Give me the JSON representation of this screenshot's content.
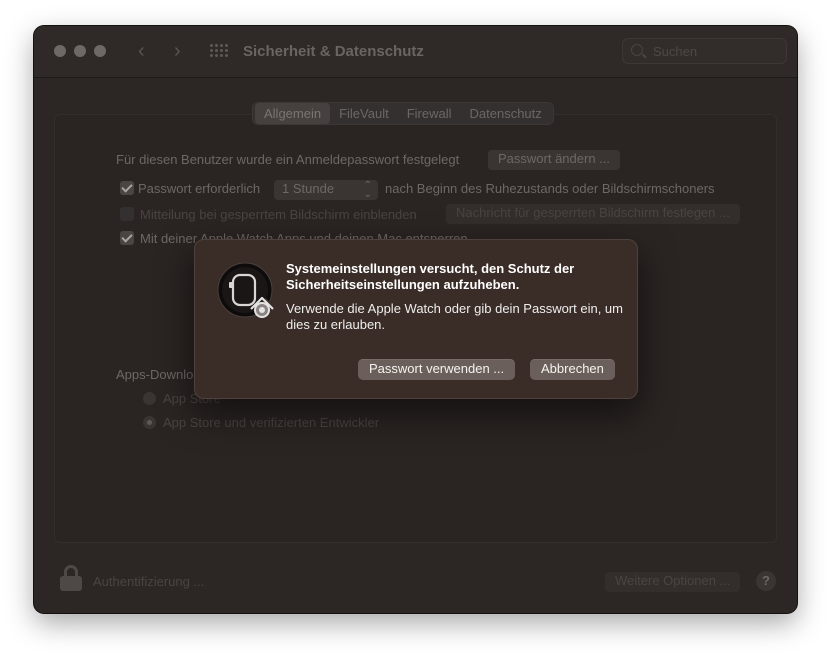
{
  "window": {
    "title": "Sicherheit & Datenschutz"
  },
  "search": {
    "placeholder": "Suchen"
  },
  "tabs": [
    "Allgemein",
    "FileVault",
    "Firewall",
    "Datenschutz"
  ],
  "general": {
    "password_set_text": "Für diesen Benutzer wurde ein Anmeldepasswort festgelegt",
    "change_password_button": "Passwort ändern ...",
    "require_password_label": "Passwort erforderlich",
    "require_password_delay": "1 Stunde",
    "require_password_suffix": "nach Beginn des Ruhezustands oder Bildschirmschoners",
    "lock_message_label": "Mitteilung bei gesperrtem Bildschirm einblenden",
    "lock_message_button": "Nachricht für gesperrten Bildschirm festlegen ...",
    "apple_watch_label": "Mit deiner Apple Watch Apps und deinen Mac entsperren"
  },
  "apps_download": {
    "heading": "Apps-Download erlauben von:",
    "option_app_store": "App Store",
    "option_app_store_devs": "App Store und verifizierten Entwickler"
  },
  "footer": {
    "auth_text": "Authentifizierung ...",
    "more_options_button": "Weitere Optionen ...",
    "help": "?"
  },
  "dialog": {
    "title": "Systemeinstellungen versucht, den Schutz der Sicherheitseinstellungen aufzuheben.",
    "message": "Verwende die Apple Watch oder gib dein Passwort ein, um dies zu erlauben.",
    "use_password_button": "Passwort verwenden ...",
    "cancel_button": "Abbrechen"
  }
}
